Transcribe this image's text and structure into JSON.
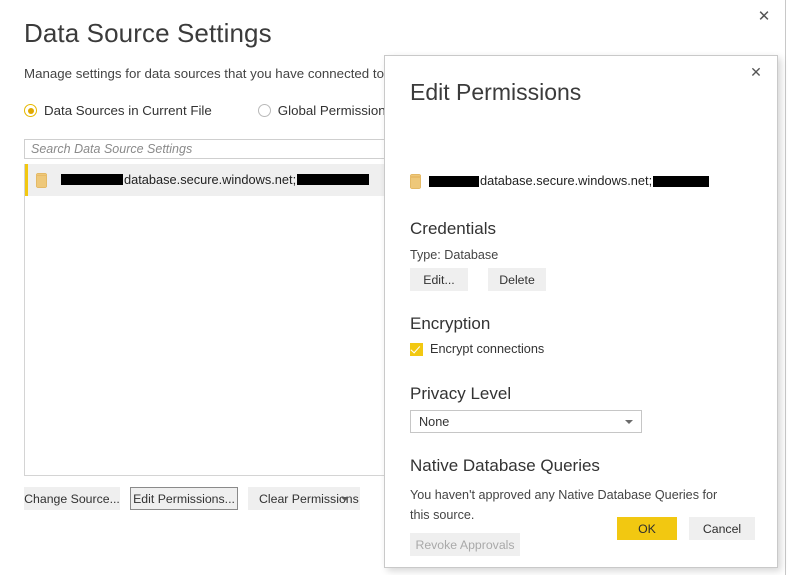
{
  "main_window": {
    "title": "Data Source Settings",
    "subtitle": "Manage settings for data sources that you have connected to",
    "close_icon": "close-icon",
    "scope": {
      "options": [
        {
          "label": "Data Sources in Current File",
          "selected": true
        },
        {
          "label": "Global Permissions",
          "selected": false
        }
      ]
    },
    "search": {
      "placeholder": "Search Data Source Settings",
      "value": ""
    },
    "list": {
      "rows": [
        {
          "icon": "database-icon",
          "redacted_prefix_width": 62,
          "text": "database.secure.windows.net;",
          "redacted_suffix_width": 72,
          "selected": true
        }
      ]
    },
    "buttons": {
      "change_source": "Change Source...",
      "edit_permissions": "Edit Permissions...",
      "clear_permissions": "Clear Permissions"
    }
  },
  "edit_permissions_dialog": {
    "title": "Edit Permissions",
    "close_icon": "close-icon",
    "source": {
      "icon": "database-icon",
      "redacted_prefix_width": 50,
      "text": "database.secure.windows.net;",
      "redacted_suffix_width": 56
    },
    "credentials": {
      "heading": "Credentials",
      "type_label": "Type: Database",
      "edit_button": "Edit...",
      "delete_button": "Delete"
    },
    "encryption": {
      "heading": "Encryption",
      "checkbox_label": "Encrypt connections",
      "checked": true
    },
    "privacy_level": {
      "heading": "Privacy Level",
      "selected": "None"
    },
    "native_queries": {
      "heading": "Native Database Queries",
      "description": "You haven't approved any Native Database Queries for this source.",
      "revoke_button": "Revoke Approvals",
      "revoke_disabled": true
    },
    "footer": {
      "ok": "OK",
      "cancel": "Cancel"
    }
  },
  "colors": {
    "accent_yellow": "#F2C811",
    "selection_gray": "#efefef",
    "text_primary": "#333333",
    "border_gray": "#c9c9c9"
  }
}
